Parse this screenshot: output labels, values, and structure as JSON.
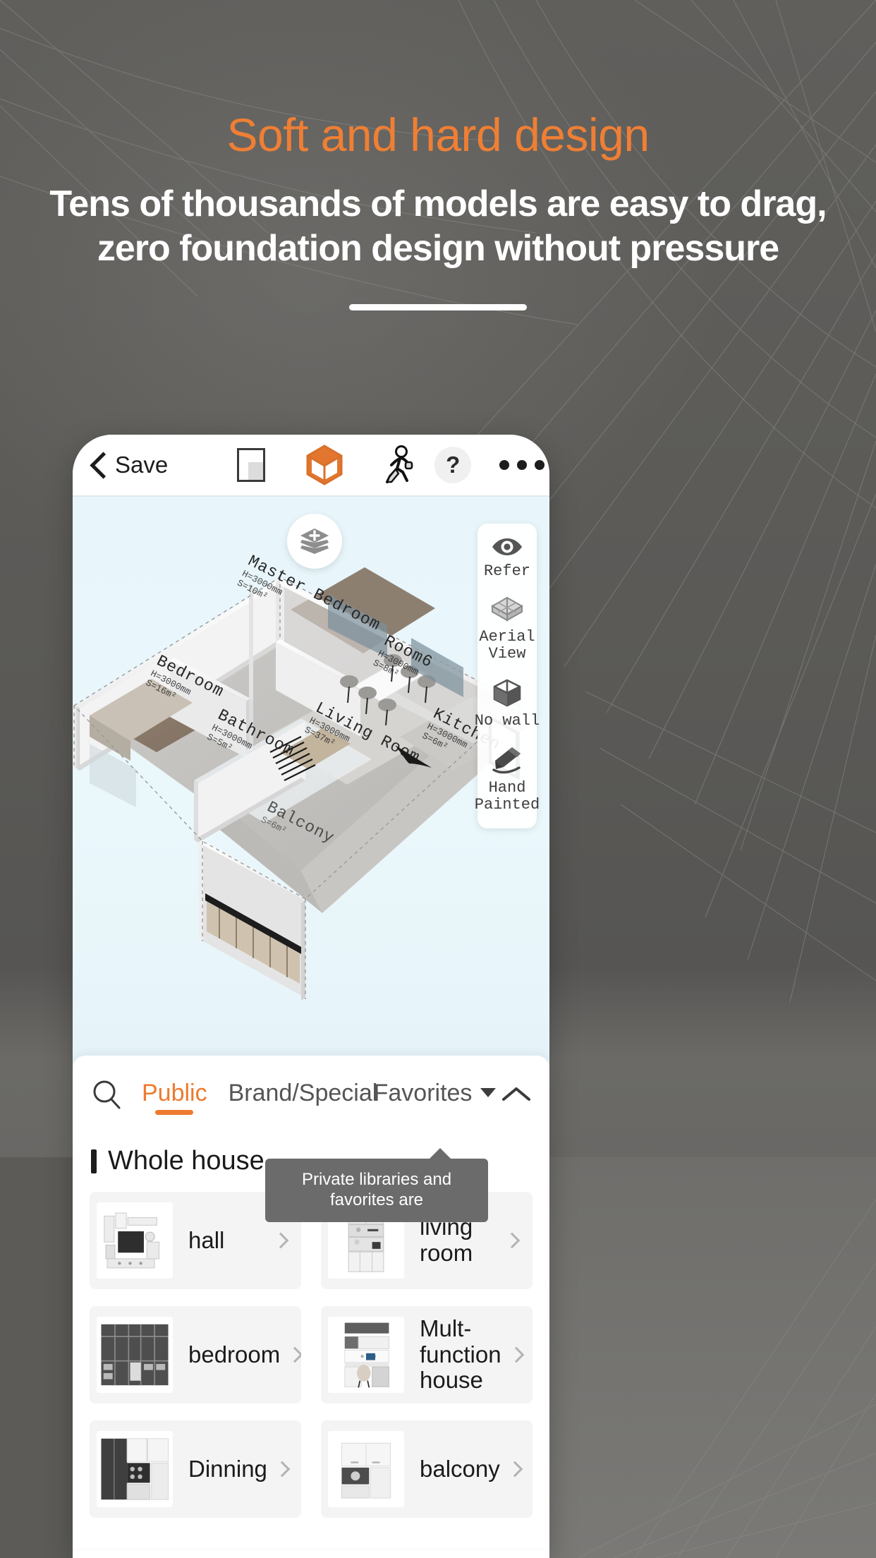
{
  "promo": {
    "title": "Soft and hard design",
    "subtitle": "Tens of thousands of models are easy to drag, zero foundation design without pressure",
    "accent_color": "#ef7f34",
    "background_color": "#5a5957"
  },
  "app": {
    "toolbar": {
      "back_icon": "chevron-left-icon",
      "save_label": "Save",
      "floorplan_icon": "floorplan-icon",
      "cube3d_icon": "cube-3d-icon",
      "walkthrough_icon": "walking-person-icon",
      "help_label": "?",
      "more_icon": "more-dots-icon"
    },
    "viewport": {
      "layers_icon": "layers-add-icon",
      "background_color": "#e9f7fb",
      "tools": [
        {
          "icon": "eye-icon",
          "label": "Refer"
        },
        {
          "icon": "aerial-box-icon",
          "label": "Aerial\nView"
        },
        {
          "icon": "cube-outline-icon",
          "label": "No wall"
        },
        {
          "icon": "pen-icon",
          "label": "Hand\nPainted"
        }
      ],
      "rooms": [
        {
          "name": "Master Bedroom",
          "height": "H=3000mm",
          "area": "S=10m²"
        },
        {
          "name": "Bedroom",
          "height": "H=3000mm",
          "area": "S=16m²"
        },
        {
          "name": "Bathroom",
          "height": "H=3000mm",
          "area": "S=5m²"
        },
        {
          "name": "Living Room",
          "height": "H=3000mm",
          "area": "S=37m²"
        },
        {
          "name": "Room6",
          "height": "H=3000mm",
          "area": "S=8m²"
        },
        {
          "name": "Kitchen",
          "height": "H=3000mm",
          "area": "S=6m²"
        },
        {
          "name": "Balcony",
          "height": "H=3000mm",
          "area": "S=6m²"
        }
      ]
    },
    "library": {
      "search_icon": "search-icon",
      "tabs": [
        {
          "label": "Public",
          "active": true
        },
        {
          "label": "Brand/Special",
          "active": false
        },
        {
          "label": "Favorites",
          "active": false,
          "has_caret": true
        }
      ],
      "collapse_icon": "chevron-up-icon",
      "tooltip": "Private libraries and favorites are",
      "section_title": "Whole house",
      "categories": [
        {
          "name": "hall",
          "thumb": "tv-wall-unit"
        },
        {
          "name": "living room",
          "thumb": "tall-cabinet"
        },
        {
          "name": "bedroom",
          "thumb": "dark-wardrobe"
        },
        {
          "name": "Mult-function house",
          "thumb": "desk-shelf"
        },
        {
          "name": "Dinning",
          "thumb": "dark-sideboard"
        },
        {
          "name": "balcony",
          "thumb": "laundry-cabinet"
        }
      ]
    }
  }
}
